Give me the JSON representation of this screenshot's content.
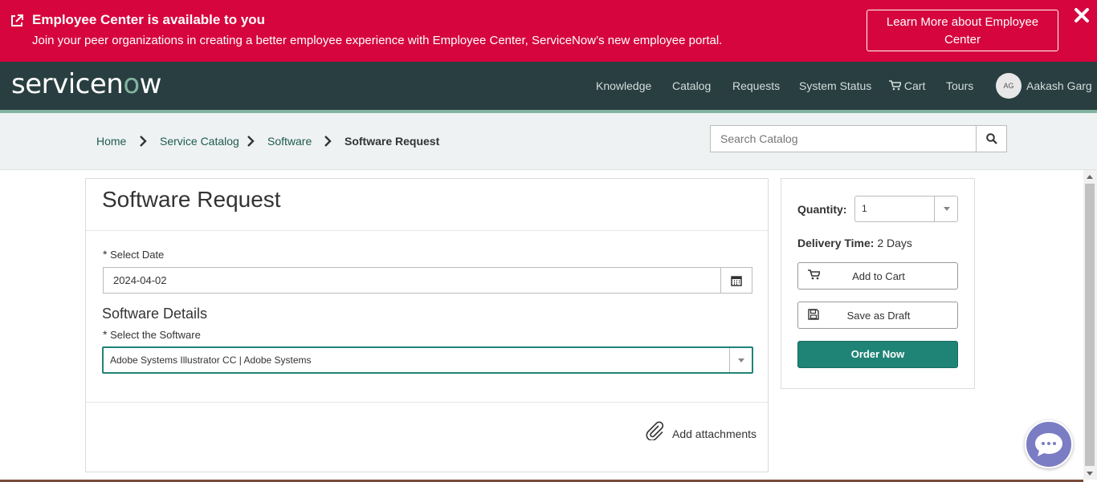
{
  "banner": {
    "title": "Employee Center is available to you",
    "text": "Join your peer organizations in creating a better employee experience with Employee Center, ServiceNow’s new employee portal.",
    "learn_more": "Learn More about Employee Center",
    "bg_color": "#d6053e"
  },
  "nav": {
    "logo": "servicenow",
    "links": [
      "Knowledge",
      "Catalog",
      "Requests",
      "System Status",
      "Cart",
      "Tours"
    ],
    "user_initials": "AG",
    "user_name": "Aakash Garg",
    "bg_color": "#293e40"
  },
  "breadcrumb": {
    "items": [
      "Home",
      "Service Catalog",
      "Software",
      "Software Request"
    ]
  },
  "search": {
    "placeholder": "Search Catalog"
  },
  "form": {
    "title": "Software Request",
    "date_label": "Select Date",
    "date_value": "2024-04-02",
    "section_heading": "Software Details",
    "software_label": "Select the Software",
    "software_value": "Adobe Systems Illustrator CC | Adobe Systems",
    "attach_label": "Add attachments",
    "required_marker": "*"
  },
  "order": {
    "quantity_label": "Quantity:",
    "quantity_value": "1",
    "delivery_label": "Delivery Time:",
    "delivery_value": "2 Days",
    "add_to_cart": "Add to Cart",
    "save_draft": "Save as Draft",
    "order_now": "Order Now",
    "accent_color": "#1f8476"
  }
}
